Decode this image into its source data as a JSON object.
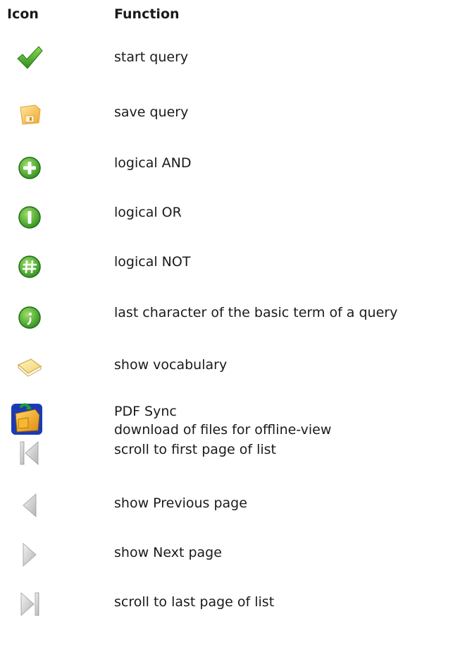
{
  "header": {
    "icon_label": "Icon",
    "function_label": "Function"
  },
  "rows": [
    {
      "icon": "checkmark-icon",
      "lines": [
        "start query"
      ]
    },
    {
      "icon": "save-icon",
      "lines": [
        "save query"
      ]
    },
    {
      "icon": "plus-circle-icon",
      "lines": [
        "logical AND"
      ]
    },
    {
      "icon": "bar-circle-icon",
      "lines": [
        "logical OR"
      ]
    },
    {
      "icon": "hash-circle-icon",
      "lines": [
        "logical NOT"
      ]
    },
    {
      "icon": "semicolon-circle-icon",
      "lines": [
        "last character of the basic term of a query"
      ]
    },
    {
      "icon": "book-icon",
      "lines": [
        "show vocabulary"
      ]
    },
    {
      "icon": "pdf-sync-icon",
      "lines": [
        "PDF Sync",
        "download of files for offline-view"
      ]
    },
    {
      "icon": "first-page-icon",
      "lines": [
        "scroll to first page of list"
      ]
    },
    {
      "icon": "previous-page-icon",
      "lines": [
        "show Previous page"
      ]
    },
    {
      "icon": "next-page-icon",
      "lines": [
        "show Next page"
      ]
    },
    {
      "icon": "last-page-icon",
      "lines": [
        "scroll to last page of list"
      ]
    }
  ],
  "colors": {
    "text": "#1a1a1a",
    "green": "#4cae2c",
    "green_dark": "#2e7d1a",
    "folder_yellow": "#f4c430",
    "gray_arrow": "#c8c8c8"
  }
}
